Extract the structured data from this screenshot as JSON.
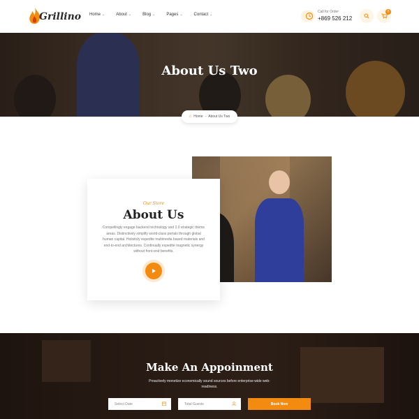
{
  "brand": {
    "name": "Grillino"
  },
  "nav": [
    {
      "label": "Home"
    },
    {
      "label": "About"
    },
    {
      "label": "Blog"
    },
    {
      "label": "Pages"
    },
    {
      "label": "Contact"
    }
  ],
  "call": {
    "label": "Call for Order",
    "number": "+869 526 212"
  },
  "cart": {
    "count": "0"
  },
  "hero": {
    "title": "About Us Two"
  },
  "breadcrumb": {
    "home": "Home",
    "separator": "-",
    "current": "About Us Two"
  },
  "about": {
    "eyebrow": "Our Store",
    "title": "About Us",
    "text": "Compellingly engage backend technology and 2.0 strategic theme areas. Distinctively simplify world-class portals through global human capital. Holisticly expedite multimedia based materials and end-to-end architectures. Continually expedite magnetic synergy without front-end benefits."
  },
  "appointment": {
    "title": "Make An Appoinment",
    "subtitle": "Proactively monetize economically sound sources before enterprise-wide web-readiness.",
    "date_placeholder": "Select Date",
    "guests_placeholder": "Total Guests",
    "button": "Book Now"
  },
  "colors": {
    "accent": "#f38b11",
    "dark": "#222222"
  },
  "icons": {
    "logo": "flame-icon",
    "call": "clock-icon",
    "search": "search-icon",
    "cart": "cart-icon",
    "play": "play-icon",
    "date": "calendar-icon",
    "guests": "user-icon"
  }
}
